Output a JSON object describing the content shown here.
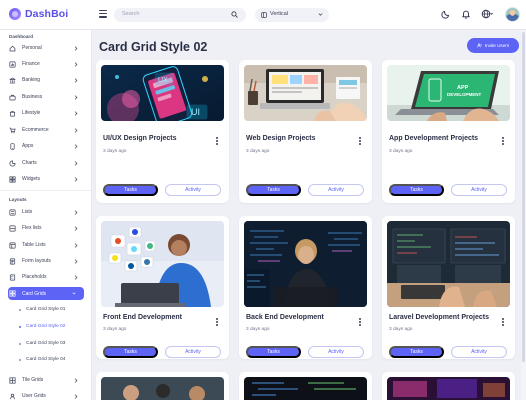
{
  "app": {
    "name": "DashBoi"
  },
  "topbar": {
    "search_placeholder": "Search",
    "layout_select": {
      "value": "Vertical"
    }
  },
  "sidebar": {
    "sections": [
      {
        "title": "Dashboard"
      },
      {
        "title": "Layouts"
      }
    ],
    "dashboard_items": [
      {
        "label": "Personal"
      },
      {
        "label": "Finance"
      },
      {
        "label": "Banking"
      },
      {
        "label": "Business"
      },
      {
        "label": "Lifestyle"
      },
      {
        "label": "Ecommerce"
      },
      {
        "label": "Apps"
      },
      {
        "label": "Charts"
      },
      {
        "label": "Widgets"
      }
    ],
    "layout_items": [
      {
        "label": "Lists"
      },
      {
        "label": "Flex lists"
      },
      {
        "label": "Table Lists"
      },
      {
        "label": "Form layouts"
      },
      {
        "label": "Placeholds"
      },
      {
        "label": "Card Grids",
        "active": true
      }
    ],
    "card_grid_subitems": [
      {
        "label": "Card Grid Style 01"
      },
      {
        "label": "Card Grid Style 02",
        "active": true
      },
      {
        "label": "Card Grid Style 03"
      },
      {
        "label": "Card Grid Style 04"
      }
    ],
    "bottom_items": [
      {
        "label": "Tile Grids"
      },
      {
        "label": "User Grids"
      }
    ]
  },
  "main": {
    "title": "Card Grid Style 02",
    "invite_label": "Invite Users",
    "cards": [
      {
        "title": "UI/UX Design Projects",
        "subtitle": "3 days ago",
        "primary": "Tasks",
        "secondary": "Activity"
      },
      {
        "title": "Web Design Projects",
        "subtitle": "3 days ago",
        "primary": "Tasks",
        "secondary": "Activity"
      },
      {
        "title": "App Development Projects",
        "subtitle": "3 days ago",
        "primary": "Tasks",
        "secondary": "Activity"
      },
      {
        "title": "Front End Development",
        "subtitle": "3 days ago",
        "primary": "Tasks",
        "secondary": "Activity"
      },
      {
        "title": "Back End Development",
        "subtitle": "3 days ago",
        "primary": "Tasks",
        "secondary": "Activity"
      },
      {
        "title": "Laravel Development Projects",
        "subtitle": "3 days ago",
        "primary": "Tasks",
        "secondary": "Activity"
      }
    ],
    "image_texts": {
      "uiux": [
        "UX",
        "UI"
      ],
      "appdev": [
        "APP",
        "DEVELOPMENT"
      ]
    }
  },
  "colors": {
    "accent": "#5d63f5",
    "background": "#eef0f6",
    "text": "#2b2f45"
  },
  "icons": [
    "hamburger-icon",
    "search-icon",
    "layout-icon",
    "moon-icon",
    "bell-icon",
    "globe-icon",
    "user-plus-icon",
    "more-vertical-icon",
    "chevron-right-icon",
    "chevron-down-icon"
  ]
}
